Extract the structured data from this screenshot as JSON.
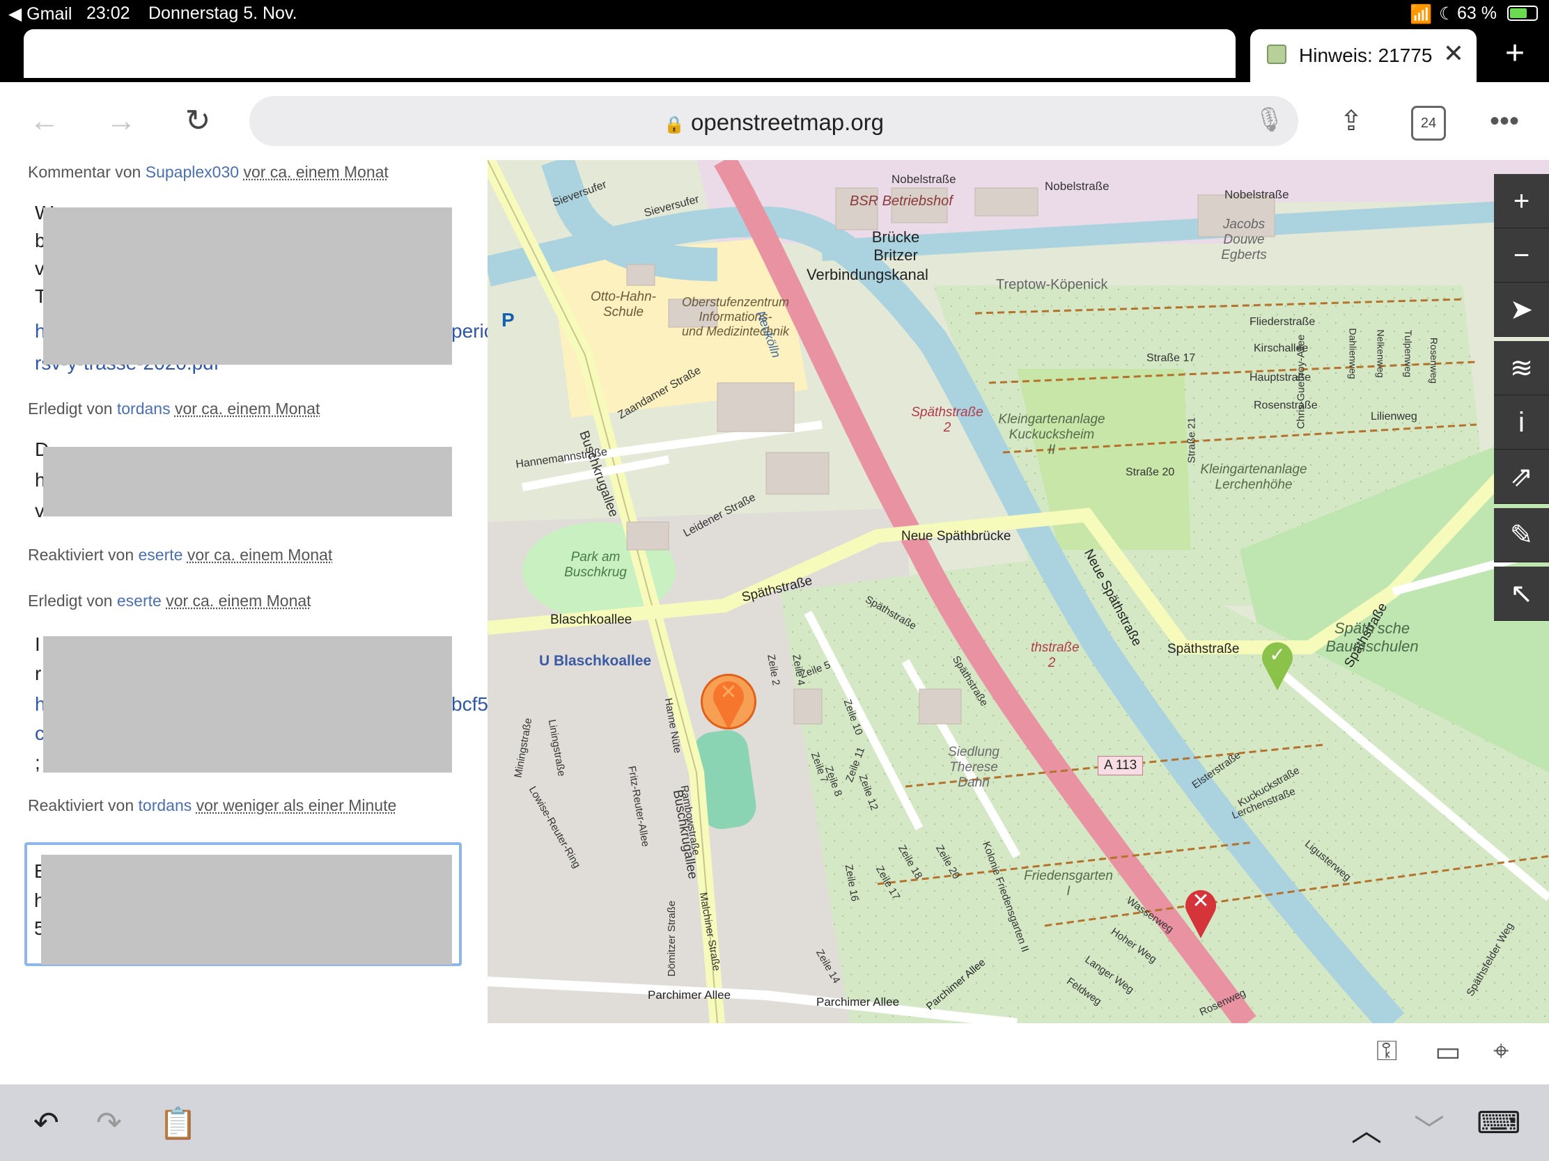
{
  "status": {
    "back_app": "Gmail",
    "time": "23:02",
    "date": "Donnerstag 5. Nov.",
    "battery": "63 %"
  },
  "tabs": {
    "active_title": "Hinweis: 21775"
  },
  "browser": {
    "url": "openstreetmap.org",
    "tab_count": "24"
  },
  "comments": [
    {
      "prefix": "Kommentar von",
      "user": "Supaplex030",
      "time": "vor ca. einem Monat",
      "peek": [
        "W",
        "b",
        "v",
        "T",
        "h",
        "rsv-y-trasse-2020.pdf"
      ],
      "peek_right": "peric"
    },
    {
      "prefix": "Erledigt von",
      "user": "tordans",
      "time": "vor ca. einem Monat",
      "peek": [
        "D",
        "h",
        "v"
      ]
    },
    {
      "prefix": "Reaktiviert von",
      "user": "eserte",
      "time": "vor ca. einem Monat"
    },
    {
      "prefix": "Erledigt von",
      "user": "eserte",
      "time": "vor ca. einem Monat",
      "peek": [
        "I",
        "r",
        "h",
        "c",
        ";"
      ],
      "peek_right": "bcf5"
    },
    {
      "prefix": "Reaktiviert von",
      "user": "tordans",
      "time": "vor weniger als einer Minute"
    }
  ],
  "composer_peek": [
    "E",
    "h",
    "5"
  ],
  "map": {
    "labels": {
      "nobel1": "Nobelstraße",
      "nobel2": "Nobelstraße",
      "nobel3": "Nobelstraße",
      "bsr": "BSR Betriebshof",
      "bruecke": "Brücke",
      "britzer": "Britzer",
      "verbindung": "Verbindungskanal",
      "treptow": "Treptow-Köpenick",
      "jacobs": "Jacobs",
      "douwe": "Douwe",
      "egberts": "Egberts",
      "sievers1": "Sieversufer",
      "sievers2": "Sieversufer",
      "otto1": "Otto-Hahn-",
      "otto2": "Schule",
      "ober1": "Oberstufenzentrum",
      "ober2": "Informations-",
      "ober3": "und Medizintechnik",
      "neukoelln": "Neukölln",
      "spaeth2": "Späthstraße",
      "spaeth2n": "2",
      "klein1": "Kleingartenanlage",
      "klein2": "Kuckucksheim",
      "klein3": "II",
      "klein4": "Kleingartenanlage",
      "klein5": "Lerchenhöhe",
      "flieder": "Fliederstraße",
      "kirsch": "Kirschallee",
      "haupt": "Hauptstraße",
      "rosen": "Rosenstraße",
      "lilien": "Lilienweg",
      "str17": "Straße 17",
      "str20": "Straße 20",
      "str21": "Straße 21",
      "chris": "Chris-Gueffroy-Allee",
      "dahlien": "Dahlienweg",
      "nelken": "Nelkenweg",
      "tulpen": "Tulpenweg",
      "rosenweg_v": "Rosenweg",
      "zaandamer": "Zaandamer Straße",
      "hannemann": "Hannemannstraße",
      "buschkrug1": "Buschkrugallee",
      "buschkrug2": "Buschkrugallee",
      "leidener": "Leidener Straße",
      "neue_bruecke": "Neue Späthbrücke",
      "neue_spaeth": "Neue Späthstraße",
      "park1": "Park am",
      "park2": "Buschkrug",
      "blaschko": "Blaschkoallee",
      "ublaschko": "U Blaschkoallee",
      "spaeth_a": "Späthstraße",
      "spaeth_b": "Späthstraße",
      "spaeth_c": "Späthstraße",
      "spaeth_d": "Späthstraße",
      "spaeth_e": "Späthstraße",
      "spaeth_f": "thstraße",
      "spaeth_fn": "2",
      "baum1": "Späth'sche",
      "baum2": "Baumschulen",
      "zeile2": "Zeile 2",
      "zeile4": "Zeile 4",
      "zeile5": "Zeile 5",
      "zeile10": "Zeile 10",
      "zeile7": "Zeile 7",
      "zeile8": "Zeile 8",
      "zeile11": "Zeile 11",
      "zeile12": "Zeile 12",
      "zeile16": "Zeile 16",
      "zeile17": "Zeile 17",
      "zeile18": "Zeile 18",
      "zeile20": "Zeile 20",
      "zeile14": "Zeile 14",
      "sied1": "Siedlung",
      "sied2": "Therese",
      "sied3": "Dahn",
      "a113": "A 113",
      "elster": "Elsterstraße",
      "kuckuck": "Kuckuckstraße",
      "lerchen": "Lerchenstraße",
      "liguster": "Ligusterweg",
      "friedens1": "Friedensgarten",
      "friedens2": "I",
      "kolonie": "Kolonie Friedensgarten II",
      "wasser": "Wasserweg",
      "hoher": "Hoher Weg",
      "langer": "Langer Weg",
      "feld": "Feldweg",
      "rosenweg": "Rosenweg",
      "parchimer1": "Parchimer Allee",
      "parchimer2": "Parchimer Allee",
      "parchimer3": "Parchimer Allee",
      "mining": "Miningstraße",
      "lining": "Liningstraße",
      "lowise": "Lowise-Reuter-Ring",
      "fritz": "Fritz-Reuter-Allee",
      "hanne": "Hanne Nüte",
      "rambow": "Rambowstraße",
      "doemitzer": "Dömitzer Straße",
      "malchiner": "Malchiner Straße",
      "spaethfelder": "Späthsfelder Weg",
      "p": "P"
    }
  },
  "colors": {
    "motorway": "#e892a2",
    "water": "#aad3df",
    "primary": "#f6fabb",
    "park": "#cdebb0",
    "allotment": "#c9e1bf",
    "residential": "#e0dfdf",
    "note_open": "#d6343b",
    "note_closed": "#8bc34a"
  }
}
